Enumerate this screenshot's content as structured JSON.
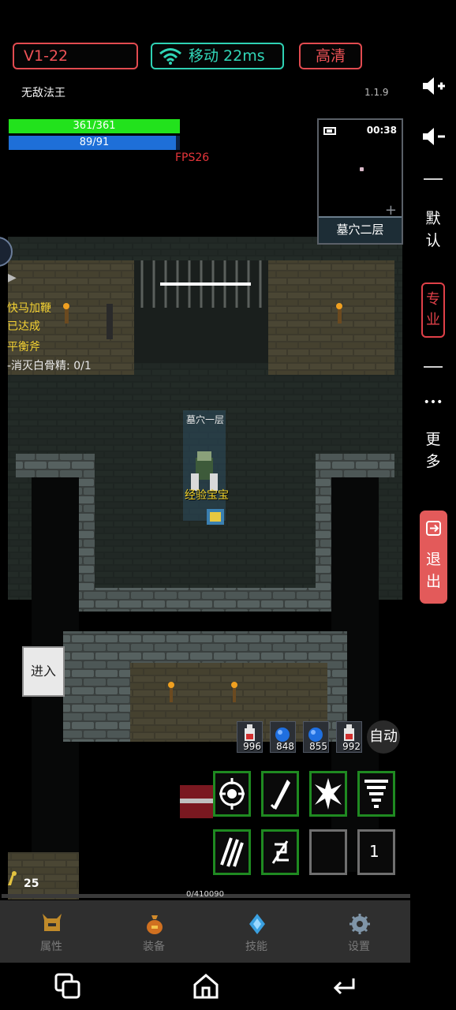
{
  "status_bar": {
    "version_label": "V1-22",
    "network_label": "移动 22ms",
    "quality_label": "高清"
  },
  "player": {
    "name": "无敌法王",
    "game_version": "1.1.9",
    "hp_text": "361/361",
    "hp_fraction": 1.0,
    "mp_text": "89/91",
    "mp_fraction": 0.978,
    "fps_text": "FPS26"
  },
  "minimap": {
    "time": "00:38",
    "plus": "+",
    "floor_name": "墓穴二层"
  },
  "quest": {
    "title": "快马加鞭",
    "status": "已达成",
    "name": "平衡斧",
    "task": "-消灭白骨精: 0/1"
  },
  "world": {
    "floor_label": "墓穴一层",
    "pet_name": "经验宝宝"
  },
  "enter_button": {
    "label": "进入"
  },
  "potions": [
    {
      "icon": "red-potion-icon",
      "count": "996"
    },
    {
      "icon": "blue-potion-icon",
      "count": "848"
    },
    {
      "icon": "blue-potion-icon",
      "count": "855"
    },
    {
      "icon": "red-potion-icon",
      "count": "992"
    }
  ],
  "auto_button": {
    "label": "自动"
  },
  "skills": {
    "row1": [
      "shield-burst-skill-icon",
      "slash-skill-icon",
      "explosion-skill-icon",
      "tornado-skill-icon"
    ],
    "row2": [
      "claw-skill-icon",
      "rune-skill-icon",
      "empty-slot",
      "count-slot"
    ],
    "slot_count": "1"
  },
  "level": {
    "value": "25"
  },
  "experience": {
    "text": "0/410090",
    "fraction": 0.0
  },
  "bottom_menu": [
    {
      "icon": "helmet-icon",
      "label": "属性"
    },
    {
      "icon": "bag-icon",
      "label": "装备"
    },
    {
      "icon": "crystal-icon",
      "label": "技能"
    },
    {
      "icon": "gear-icon",
      "label": "设置"
    }
  ],
  "right_rail": {
    "default_label_1": "默",
    "default_label_2": "认",
    "pro_label_1": "专",
    "pro_label_2": "业",
    "more_dots": "•••",
    "more_label_1": "更",
    "more_label_2": "多",
    "exit_label_1": "退",
    "exit_label_2": "出"
  },
  "colors": {
    "accent_red": "#e24b50",
    "network_teal": "#2fd1b4",
    "hp_green": "#22e21c",
    "mp_blue": "#1e6fd8",
    "skill_border": "#1f8a21",
    "exit_button": "#e35a5a"
  }
}
